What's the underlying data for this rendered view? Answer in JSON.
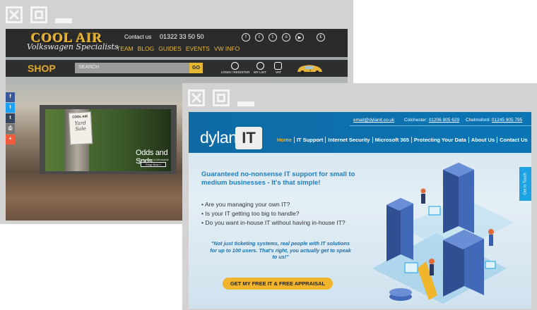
{
  "windows": {
    "controls": [
      "close",
      "maximize",
      "minimize"
    ]
  },
  "coolair": {
    "logo_main": "COOL AIR",
    "logo_sub": "Volkswagen Specialists",
    "contact_label": "Contact us",
    "phone": "01322 33 50 50",
    "nav": [
      "TEAM",
      "BLOG",
      "GUIDES",
      "EVENTS",
      "VW INFO"
    ],
    "social": [
      "f",
      "t",
      "t",
      "o",
      "▶"
    ],
    "currency": "£",
    "shop_label": "SHOP",
    "search_placeholder": "SEARCH",
    "go_label": "GO",
    "login_label": "LOGIN / REGISTER",
    "mylist_label": "MY LIST",
    "vat_label": "VAT",
    "car_badge": "0",
    "share": [
      "f",
      "t",
      "t",
      "⎙",
      "+"
    ],
    "promo": {
      "sign_title": "COOL AIR",
      "sign_text_1": "Yard",
      "sign_text_2": "Sale",
      "title": "Odds and Sods",
      "subtitle": "Designer and Affordable Sale",
      "button": "Shop Now >"
    }
  },
  "dylanit": {
    "email": "email@dylanit.co.uk",
    "colchester_label": "Colchester:",
    "colchester_phone": "01206 805 629",
    "chelmsford_label": "Chelmsford:",
    "chelmsford_phone": "01245 905 795",
    "logo_text": "dylan",
    "logo_box": "IT",
    "nav": [
      "Home",
      "IT Support",
      "Internet Security",
      "Microsoft 365",
      "Protecting Your Data",
      "About Us",
      "Contact Us"
    ],
    "headline": "Guaranteed no-nonsense IT support for small to medium businesses - It's that simple!",
    "bullets": [
      "Are you managing your own IT?",
      "Is your IT getting too big to handle?",
      "Do you want in-house IT without having in-house IT?"
    ],
    "quote": "\"Not just ticketing systems, real people with IT solutions for up to 100 users. That's right, you actually get to speak to us!\"",
    "cta": "GET MY FREE IT & FREE APPRAISAL",
    "get_in_touch": "Get In Touch"
  },
  "colors": {
    "coolair_gold": "#e3b33a",
    "dylan_blue": "#0f6aa4",
    "cta_yellow": "#f0b52a"
  }
}
